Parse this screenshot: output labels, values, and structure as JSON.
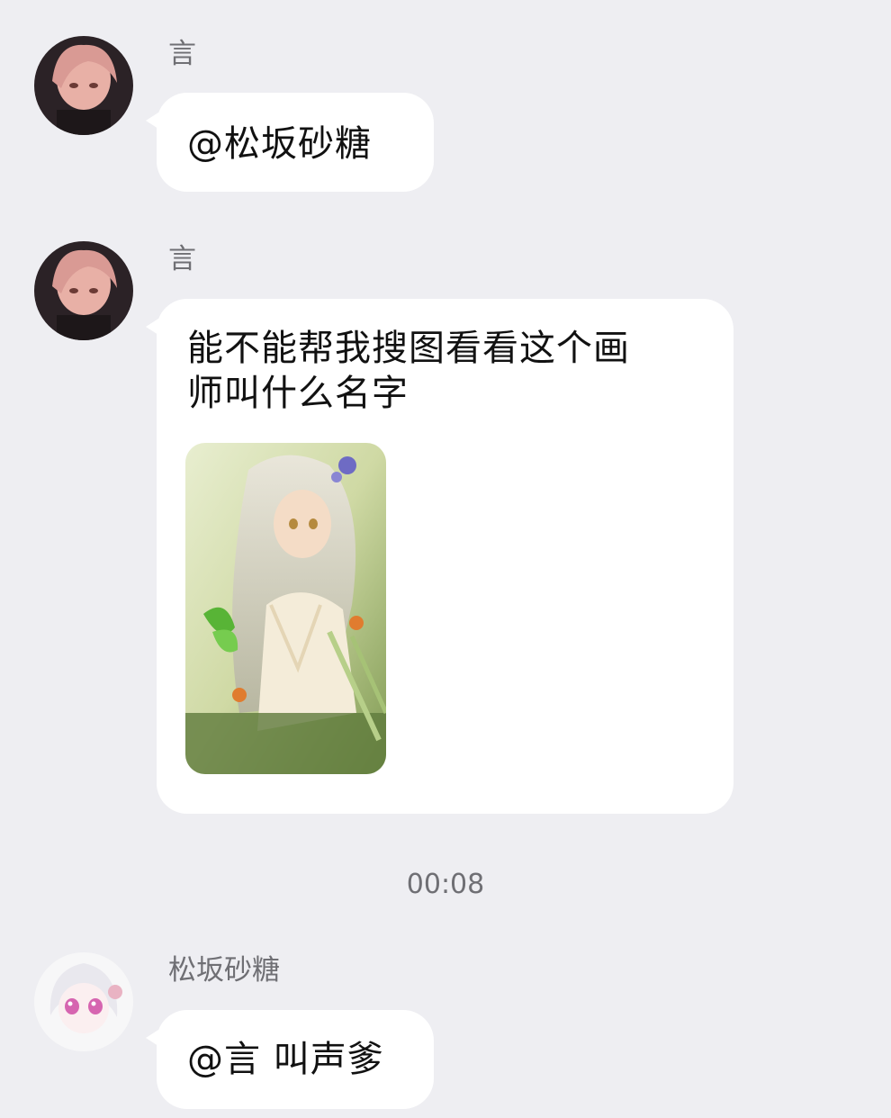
{
  "messages": [
    {
      "sender": "言",
      "text": "@松坂砂糖"
    },
    {
      "sender": "言",
      "text_line1": "能不能帮我搜图看看这个画",
      "text_line2": "师叫什么名字",
      "image_icon": "anime-illustration-image"
    },
    {
      "sender": "松坂砂糖",
      "text": "@言 叫声爹"
    }
  ],
  "timestamp": "00:08",
  "colors": {
    "background": "#eeeef2",
    "bubble": "#ffffff",
    "text": "#111111",
    "meta": "#6f6f74"
  }
}
